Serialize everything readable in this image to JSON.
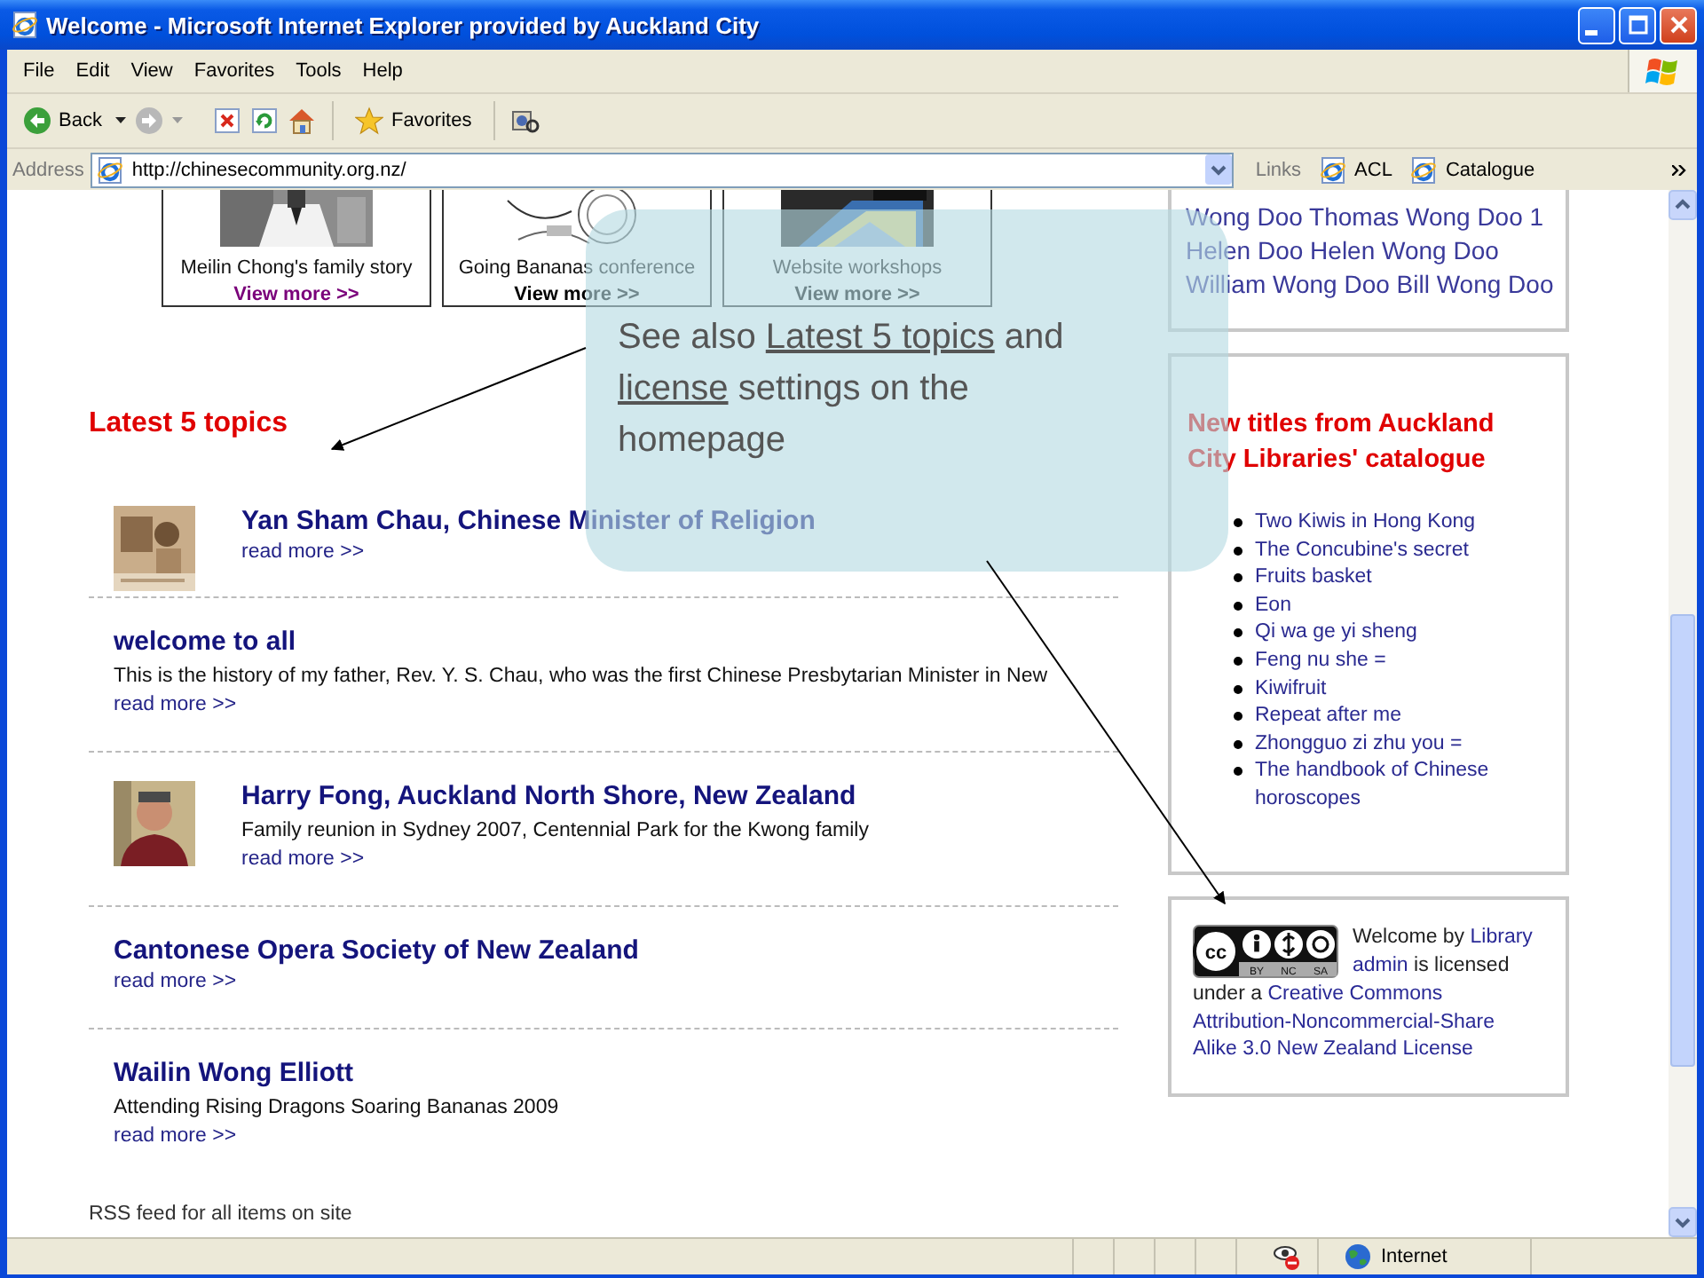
{
  "window": {
    "title": "Welcome - Microsoft Internet Explorer provided by Auckland City"
  },
  "menu": [
    "File",
    "Edit",
    "View",
    "Favorites",
    "Tools",
    "Help"
  ],
  "toolbar": {
    "back": "Back",
    "favorites": "Favorites"
  },
  "address_bar": {
    "label": "Address",
    "url": "http://chinesecommunity.org.nz/"
  },
  "links_bar": {
    "label": "Links",
    "items": [
      "ACL",
      "Catalogue"
    ]
  },
  "page": {
    "featured": [
      {
        "caption": "Meilin Chong's family story",
        "more": "View more >>",
        "visited": true
      },
      {
        "caption": "Going Bananas conference",
        "more": "View more >>",
        "visited": false
      },
      {
        "caption": "Website workshops",
        "more": "View more >>",
        "visited": false
      }
    ],
    "latest_heading": "Latest 5 topics",
    "topics": [
      {
        "kind": "thumbnail",
        "title": "Yan Sham Chau, Chinese Minister of Religion",
        "more": "read more >>"
      },
      {
        "kind": "text",
        "title": "welcome to all",
        "summary": "This is the history of my father, Rev. Y. S. Chau, who was the first Chinese Presbytarian Minister in New",
        "more": "read more >>"
      },
      {
        "kind": "thumbnail",
        "title": "Harry Fong, Auckland North Shore, New Zealand",
        "summary": "Family reunion in Sydney 2007, Centennial Park for the Kwong family",
        "more": "read more >>"
      },
      {
        "kind": "text",
        "title": "Cantonese Opera Society of New Zealand",
        "more": "read more >>"
      },
      {
        "kind": "text",
        "title": "Wailin Wong Elliott",
        "summary": "Attending Rising Dragons Soaring Bananas 2009",
        "more": "read more >>"
      }
    ],
    "rss": "RSS feed for all items on site",
    "names_box": {
      "lines": [
        "Wong Doo Thomas Wong Doo 1",
        "Helen Doo Helen Wong Doo",
        "William Wong Doo Bill Wong Doo"
      ]
    },
    "new_titles": {
      "heading": "New titles from Auckland City Libraries' catalogue",
      "items": [
        "Two Kiwis in Hong Kong",
        "The Concubine's secret",
        "Fruits basket",
        "Eon",
        "Qi wa ge yi sheng",
        "Feng nu she =",
        "Kiwifruit",
        "Repeat after me",
        "Zhongguo zi zhu you =",
        "The handbook of Chinese horoscopes"
      ]
    },
    "license": {
      "badge_mark": "cc",
      "badge_labels": [
        "BY",
        "NC",
        "SA"
      ],
      "beside_badge": [
        {
          "kind": "text",
          "text": "Welcome by"
        },
        {
          "kind": "link",
          "text": "Library"
        },
        {
          "kind": "link",
          "text": "admin"
        },
        {
          "kind": "text",
          "text": "is licensed"
        }
      ],
      "parts": [
        {
          "kind": "text",
          "text": "under a"
        },
        {
          "kind": "link",
          "text": "Creative Commons"
        },
        {
          "kind": "link",
          "text": "Attribution-Noncommercial-Share"
        },
        {
          "kind": "link",
          "text": "Alike 3.0 New Zealand License"
        }
      ]
    }
  },
  "callout": {
    "parts": [
      {
        "kind": "text",
        "text": "See also"
      },
      {
        "kind": "link",
        "text": "Latest 5 topics"
      },
      {
        "kind": "text",
        "text": "and"
      },
      {
        "kind": "link",
        "text": "license"
      },
      {
        "kind": "text",
        "text": "settings on the homepage"
      }
    ]
  },
  "status_bar": {
    "zone": "Internet"
  }
}
